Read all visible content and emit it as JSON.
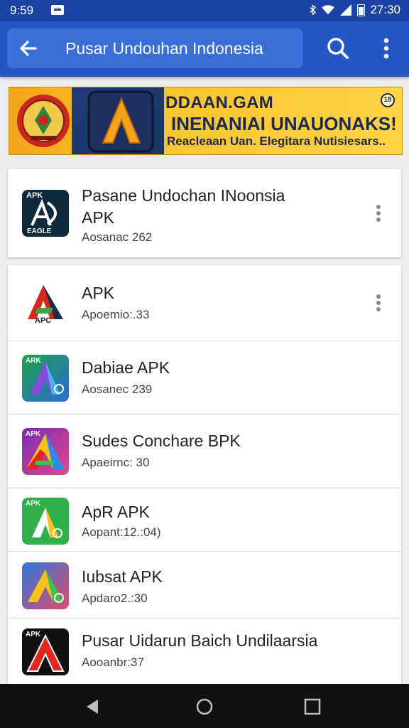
{
  "status_bar": {
    "time_left": "9:59",
    "time_right": "27:30"
  },
  "app_bar": {
    "title": "Pusar Undouhan Indonesia"
  },
  "banner": {
    "headline": "DDAAN.GAM",
    "subhead": "INENANIAI UNAUONAKS!",
    "tagline": "Reacleaan Uan. Elegitara Nutisiesars..",
    "badge": "18"
  },
  "featured": {
    "name_line1": "Pasane Undochan INoonsia",
    "name_line2": "APK",
    "sub": "Aosanac 262",
    "icon_text": "APK",
    "icon_caption": "EAGLE"
  },
  "list": [
    {
      "name": "APK",
      "sub": "Apoemio:.33",
      "icon": "apk-logo-icon",
      "icon_text": "APC"
    },
    {
      "name": "Dabiae APK",
      "sub": "Aosanec 239",
      "icon": "gradient-a-icon",
      "icon_text": "ARK"
    },
    {
      "name": "Sudes Conchare BPK",
      "sub": "Apaeirnc: 30",
      "icon": "rainbow-a-icon",
      "icon_text": "APK"
    },
    {
      "name": "ApR APK",
      "sub": "Aopant:12.:04)",
      "icon": "green-a-icon",
      "icon_text": "APK"
    },
    {
      "name": "Iubsat APK",
      "sub": "Apdaro2.:30",
      "icon": "blue-a-icon",
      "icon_text": ""
    },
    {
      "name": "Pusar Uidarun Baich Undilaarsia",
      "sub": "Aooanbr:37",
      "icon": "red-a-icon",
      "icon_text": "APK"
    }
  ]
}
